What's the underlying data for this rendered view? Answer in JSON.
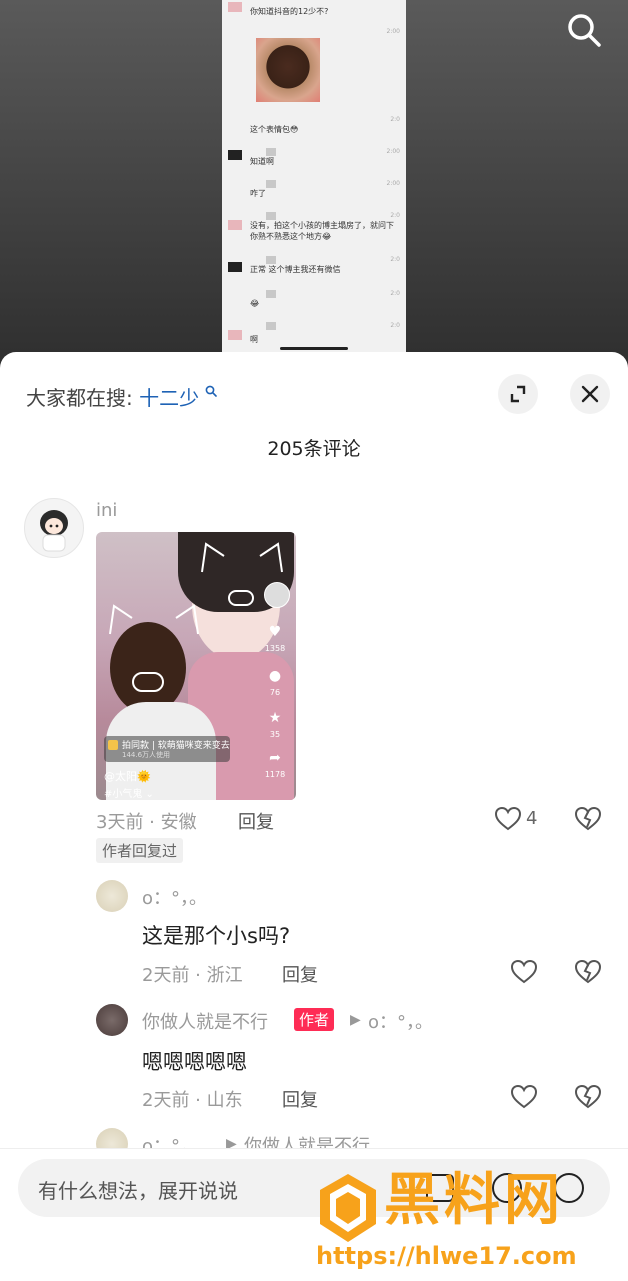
{
  "video_chat": {
    "lines": [
      {
        "time": "",
        "text": "你知道抖音的12少不?"
      },
      {
        "time": "2:00",
        "text": ""
      },
      {
        "time": "2:0",
        "text": "这个表情包😳"
      },
      {
        "time": "2:00",
        "text": "知道啊"
      },
      {
        "time": "2:00",
        "text": "咋了"
      },
      {
        "time": "2:0",
        "text": "没有，拍这个小孩的博主塌房了，就问下你熟不熟悉这个地方😂"
      },
      {
        "time": "2:0",
        "text": "正常 这个博主我还有微信"
      },
      {
        "time": "2:0",
        "text": "😂"
      },
      {
        "time": "2:0",
        "text": "啊"
      }
    ]
  },
  "header": {
    "hot_prefix": "大家都在搜:",
    "hot_term": "十二少",
    "comment_count": "205条评论"
  },
  "comments": [
    {
      "user": "ini",
      "meta": "3天前 · 安徽",
      "reply": "回复",
      "likes": "4",
      "badge": "作者回复过",
      "thumb": {
        "pill_main": "拍同款 | 软萌猫咪变来变去",
        "pill_sub": "144.6万人使用",
        "at_user": "@太阳🌞",
        "hashtag": "#小气鬼 ⌄",
        "counts": [
          "1358",
          "76",
          "35",
          "1178"
        ]
      }
    },
    {
      "user": "o：°，。",
      "content": "这是那个小s吗?",
      "meta": "2天前 · 浙江",
      "reply": "回复"
    },
    {
      "user": "你做人就是不行",
      "author_tag": "作者",
      "reply_to": "o：°，。",
      "content": "嗯嗯嗯嗯嗯",
      "meta": "2天前 · 山东",
      "reply": "回复"
    },
    {
      "user": "o：°，",
      "reply_to": "你做人就是不行"
    }
  ],
  "input": {
    "placeholder": "有什么想法，展开说说"
  },
  "watermark": {
    "brand": "黑料网",
    "url": "https://hlwe17.com"
  },
  "colors": {
    "accent_blue": "#1e62b5",
    "author_red": "#fe2c55",
    "watermark_orange": "#f7a21b"
  }
}
